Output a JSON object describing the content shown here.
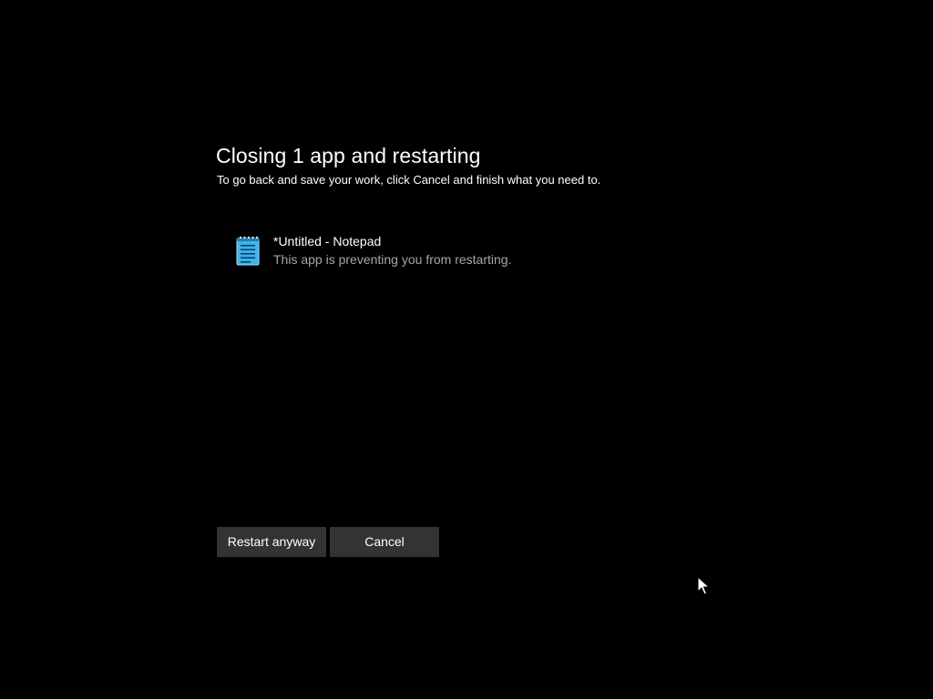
{
  "dialog": {
    "title": "Closing 1 app and restarting",
    "subtitle": "To go back and save your work, click Cancel and finish what you need to."
  },
  "apps": [
    {
      "name": "*Untitled - Notepad",
      "status": "This app is preventing you from restarting.",
      "icon": "notepad-icon"
    }
  ],
  "buttons": {
    "restart_label": "Restart anyway",
    "cancel_label": "Cancel"
  },
  "colors": {
    "background": "#000000",
    "button_bg": "#333333",
    "secondary_text": "#a6a6a6",
    "icon_accent": "#3fb3e6"
  }
}
